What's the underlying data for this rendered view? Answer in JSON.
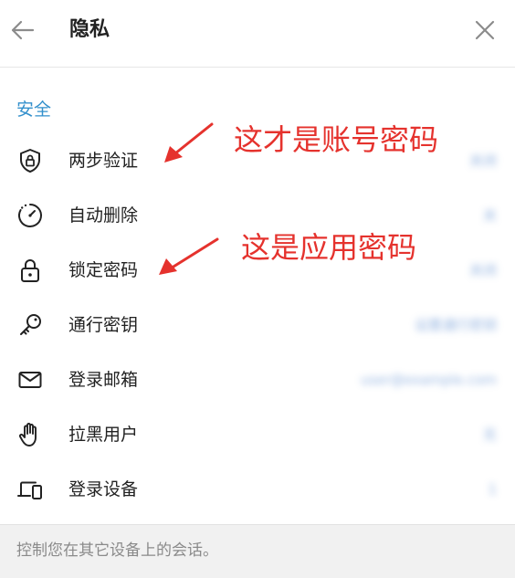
{
  "header": {
    "title": "隐私"
  },
  "section": {
    "title": "安全"
  },
  "rows": [
    {
      "label": "两步验证",
      "value": "关闭",
      "icon": "shield-lock-icon"
    },
    {
      "label": "自动删除",
      "value": "关",
      "icon": "timer-icon"
    },
    {
      "label": "锁定密码",
      "value": "关闭",
      "icon": "lock-icon"
    },
    {
      "label": "通行密钥",
      "value": "设置通行密钥",
      "icon": "key-icon"
    },
    {
      "label": "登录邮箱",
      "value": "user@example.com",
      "icon": "mail-icon"
    },
    {
      "label": "拉黑用户",
      "value": "无",
      "icon": "hand-icon"
    },
    {
      "label": "登录设备",
      "value": "1",
      "icon": "devices-icon"
    }
  ],
  "annotations": {
    "account_password": "这才是账号密码",
    "app_password": "这是应用密码"
  },
  "footer": {
    "text": "控制您在其它设备上的会话。"
  },
  "colors": {
    "accent": "#3390cc",
    "annotation": "#e5322d",
    "value": "#3f78c8"
  }
}
